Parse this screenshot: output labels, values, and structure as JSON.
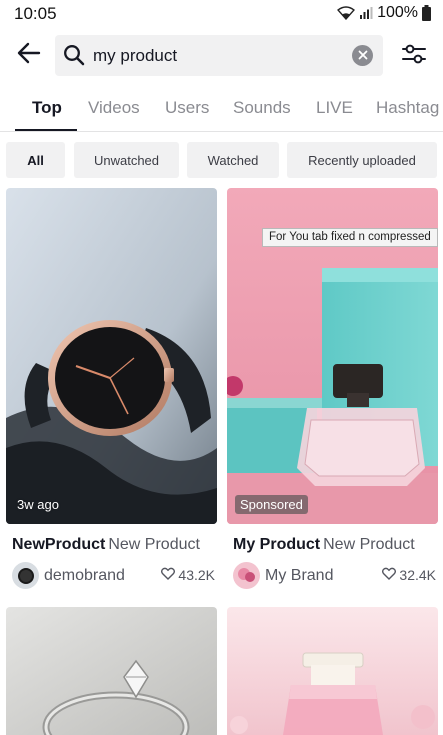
{
  "status_bar": {
    "time": "10:05",
    "battery": "100%"
  },
  "search": {
    "query": "my product"
  },
  "tabs": [
    {
      "label": "Top",
      "active": true
    },
    {
      "label": "Videos"
    },
    {
      "label": "Users"
    },
    {
      "label": "Sounds"
    },
    {
      "label": "LIVE"
    },
    {
      "label": "Hashtag"
    }
  ],
  "chips": [
    {
      "label": "All",
      "active": true
    },
    {
      "label": "Unwatched"
    },
    {
      "label": "Watched"
    },
    {
      "label": "Recently uploaded"
    }
  ],
  "tooltip": "For You tab fixed n compressed",
  "results": [
    {
      "badge": "3w ago",
      "title_bold": "NewProduct",
      "title_rest": "New Product",
      "author": "demobrand",
      "likes": "43.2K"
    },
    {
      "badge": "Sponsored",
      "title_bold": "My Product",
      "title_rest": "New Product",
      "author": "My Brand",
      "likes": "32.4K"
    }
  ],
  "colors": {
    "accent": "#161823",
    "muted": "#8a8b91",
    "chip_bg": "#f1f1f2"
  },
  "icons": [
    "back-arrow-icon",
    "search-icon",
    "clear-icon",
    "filter-sliders-icon",
    "wifi-icon",
    "signal-icon",
    "battery-icon",
    "heart-icon"
  ]
}
